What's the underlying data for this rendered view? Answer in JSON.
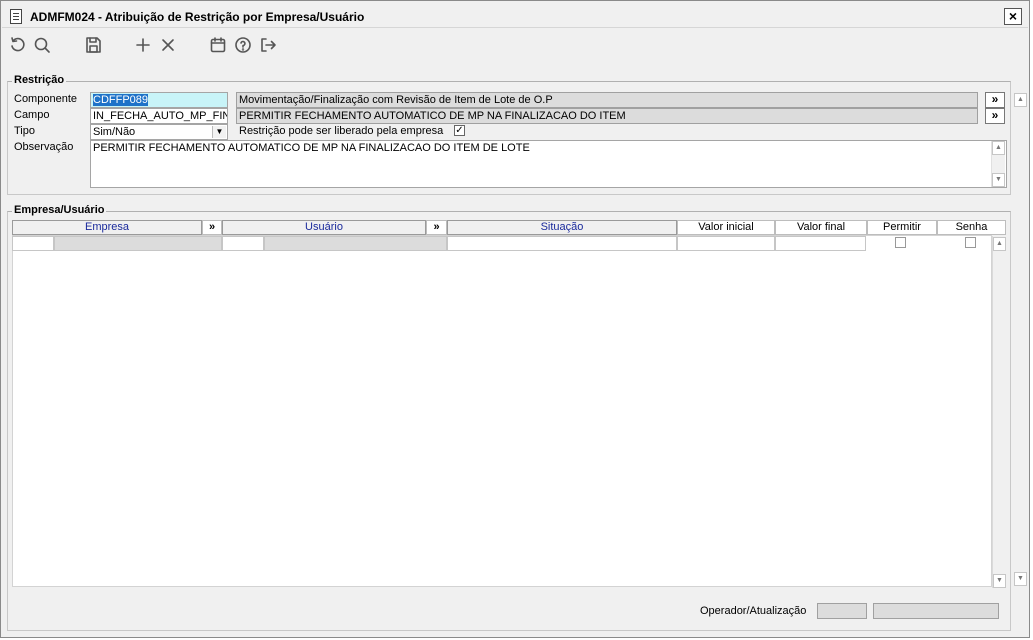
{
  "window": {
    "title": "ADMFM024 - Atribuição de Restrição por Empresa/Usuário",
    "close_label": "×"
  },
  "toolbar": {
    "icons": [
      "refresh-icon",
      "search-icon",
      "save-icon",
      "add-icon",
      "delete-icon",
      "calendar-icon",
      "help-icon",
      "exit-icon"
    ]
  },
  "restricao": {
    "group_title": "Restrição",
    "componente_label": "Componente",
    "componente_value": "CDFFP089",
    "componente_desc": "Movimentação/Finalização com Revisão de Item de Lote de O.P",
    "campo_label": "Campo",
    "campo_value": "IN_FECHA_AUTO_MP_FIN",
    "campo_desc": "PERMITIR FECHAMENTO AUTOMATICO DE MP NA FINALIZACAO DO ITEM",
    "tipo_label": "Tipo",
    "tipo_value": "Sim/Não",
    "liberado_label": "Restrição pode ser liberado pela empresa",
    "liberado_checked": true,
    "observacao_label": "Observação",
    "observacao_value": "PERMITIR FECHAMENTO AUTOMATICO DE MP NA FINALIZACAO DO ITEM DE LOTE",
    "arrow_label": "»"
  },
  "empresa_usuario": {
    "group_title": "Empresa/Usuário",
    "columns": {
      "empresa": "Empresa",
      "usuario": "Usuário",
      "situacao": "Situação",
      "valor_inicial": "Valor inicial",
      "valor_final": "Valor final",
      "permitir": "Permitir",
      "senha": "Senha"
    },
    "arrow_label": "»"
  },
  "footer": {
    "operador_label": "Operador/Atualização",
    "operador_value": "",
    "atualizacao_value": ""
  },
  "colors": {
    "selection": "#1e72c8",
    "field_highlight": "#c8f4f8",
    "header_blue_text": "#1a2a9c"
  }
}
